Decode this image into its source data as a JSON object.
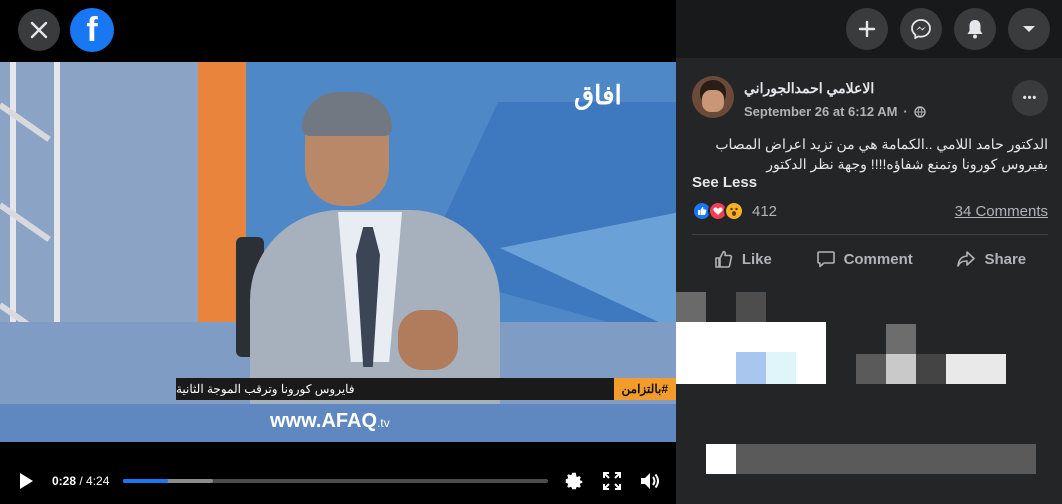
{
  "video": {
    "channel_logo": "افاق",
    "lower_third_text": "فايروس كورونا وترقب الموجة الثانية",
    "lower_third_tag": "#بالتزامن",
    "ticker_url": "www.AFAQ",
    "ticker_tld": ".tv",
    "current_time": "0:28",
    "time_separator": " / ",
    "total_time": "4:24",
    "progress_fraction": 0.106,
    "buffer_fraction": 0.21
  },
  "topbar": {
    "fb_letter": "f"
  },
  "post": {
    "author": "الاعلامي احمدالجوراني",
    "date": "September 26 at 6:12 AM",
    "separator": "·",
    "more_label": "•••",
    "text_line1": "الدكتور حامد اللامي ..الكمامة هي من تزيد اعراض المصاب",
    "text_line2": "بفيروس كورونا وتمنع شفاؤه!!!! وجهة نظر الدكتور",
    "see_less": "See Less",
    "reaction_count": "412",
    "comments_label": "34 Comments",
    "actions": {
      "like": "Like",
      "comment": "Comment",
      "share": "Share"
    }
  },
  "colors": {
    "accent": "#1877f2",
    "panel_bg": "#242526",
    "text": "#e4e6eb",
    "secondary_text": "#b0b3b8"
  }
}
